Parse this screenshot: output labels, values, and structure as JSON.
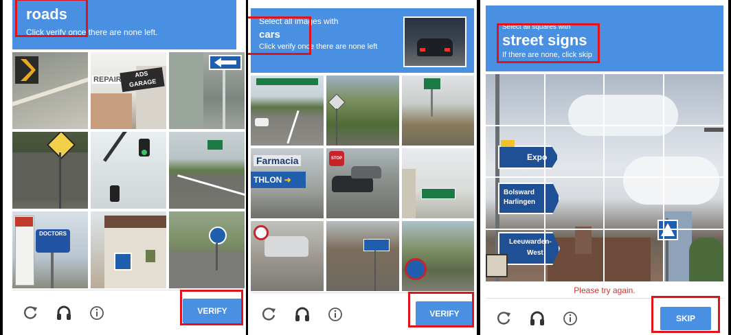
{
  "panel1": {
    "keyword": "roads",
    "instruction": "Click verify once there are none left.",
    "verify_label": "VERIFY",
    "tile_texts": {
      "garage_repair": "REPAIR",
      "garage_ads": "ADS",
      "garage_name": "GARAGE",
      "doctors": "DOCTORS"
    }
  },
  "panel2": {
    "prompt": "Select all images with",
    "keyword": "cars",
    "instruction": "Click verify once there are none left",
    "verify_label": "VERIFY",
    "tile_texts": {
      "farmacia": "Farmacia",
      "thlon": "THLON",
      "stop": "STOP"
    }
  },
  "panel3": {
    "prompt": "Select all squares with",
    "keyword": "street signs",
    "instruction": "If there are none, click skip",
    "error": "Please try again.",
    "skip_label": "SKIP",
    "sign_texts": {
      "expo": "Expo",
      "bolsward": "Bolsward",
      "harlingen": "Harlingen",
      "leeuwarden": "Leeuwarden-",
      "west": "West"
    }
  },
  "colors": {
    "header_blue": "#4a90e2",
    "highlight_red": "#e0131b",
    "error_red": "#d0342c"
  },
  "icons": [
    "reload-icon",
    "audio-icon",
    "info-icon"
  ]
}
